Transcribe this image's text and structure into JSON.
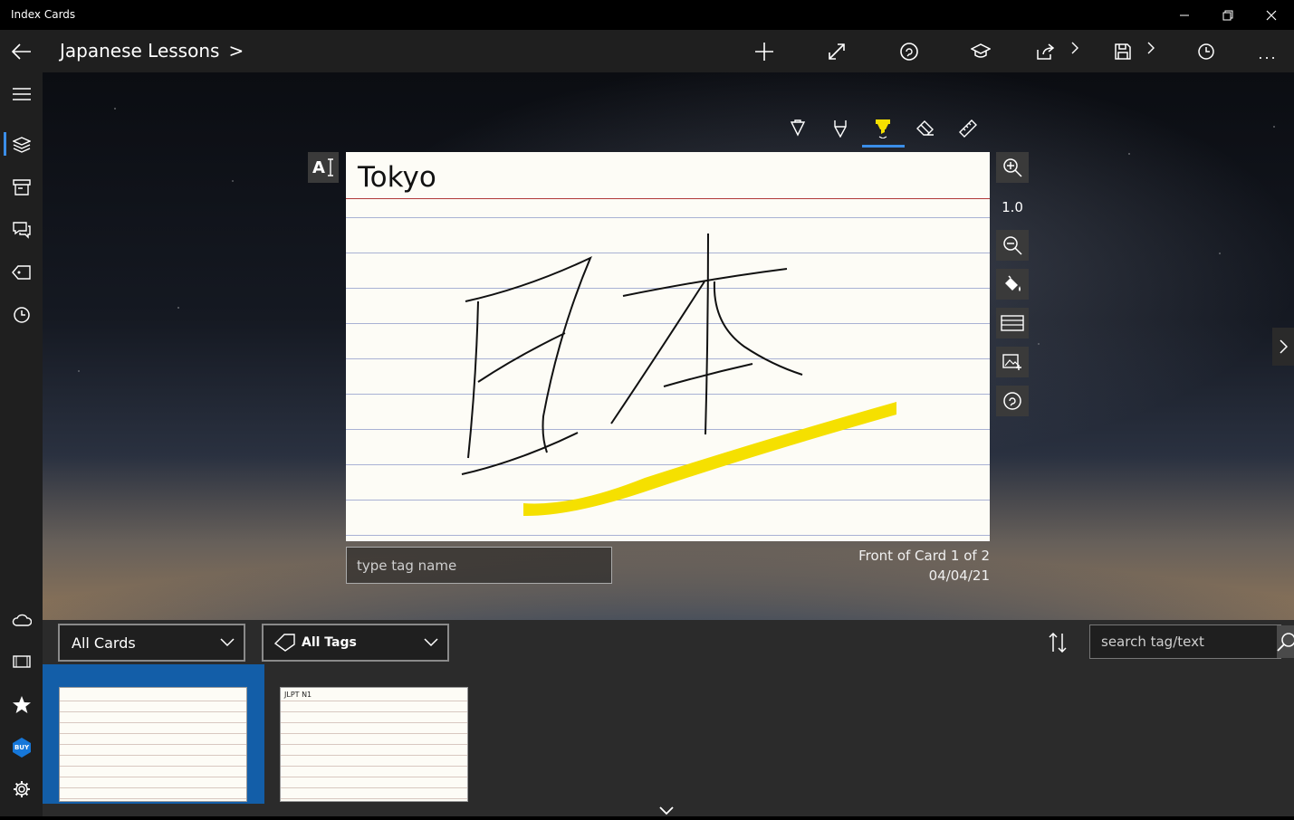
{
  "window": {
    "title": "Index Cards"
  },
  "header": {
    "deck_name": "Japanese Lessons",
    "breadcrumb_separator": ">",
    "more_label": "..."
  },
  "toolbar": {
    "items": [
      "add-icon",
      "fullscreen-icon",
      "flip-icon",
      "study-icon",
      "share-icon",
      "save-icon",
      "history-icon",
      "more-icon"
    ]
  },
  "pen_tools": {
    "items": [
      "ballpoint-pen-icon",
      "pencil-icon",
      "highlighter-icon",
      "eraser-icon",
      "ruler-icon"
    ],
    "selected": "highlighter-icon"
  },
  "editor": {
    "text_mode_label": "A",
    "zoom_level": "1.0"
  },
  "card": {
    "title": "Tokyo",
    "ink_color": "#111111",
    "highlight_color": "#f5e000",
    "header_rule_color": "#b03838",
    "line_color": "#a9b2d4"
  },
  "tag_input": {
    "placeholder": "type tag name"
  },
  "card_info": {
    "position": "Front of Card 1 of 2",
    "date": "04/04/21"
  },
  "filters": {
    "cards_filter": "All Cards",
    "tags_filter": "All Tags"
  },
  "search": {
    "placeholder": "search tag/text"
  },
  "thumbnails": [
    {
      "tag": "",
      "selected": true
    },
    {
      "tag": "JLPT N1",
      "selected": false
    }
  ],
  "sidebar": {
    "items": [
      "hamburger-icon",
      "decks-icon",
      "archive-icon",
      "quiz-icon",
      "tags-icon",
      "history-icon",
      "cloud-icon",
      "slideshow-icon",
      "favorite-icon",
      "buy-icon",
      "settings-icon"
    ],
    "buy_label": "BUY"
  },
  "colors": {
    "accent": "#3b8ee8",
    "selection": "#135ea8",
    "appbar": "#1f1f1f"
  }
}
